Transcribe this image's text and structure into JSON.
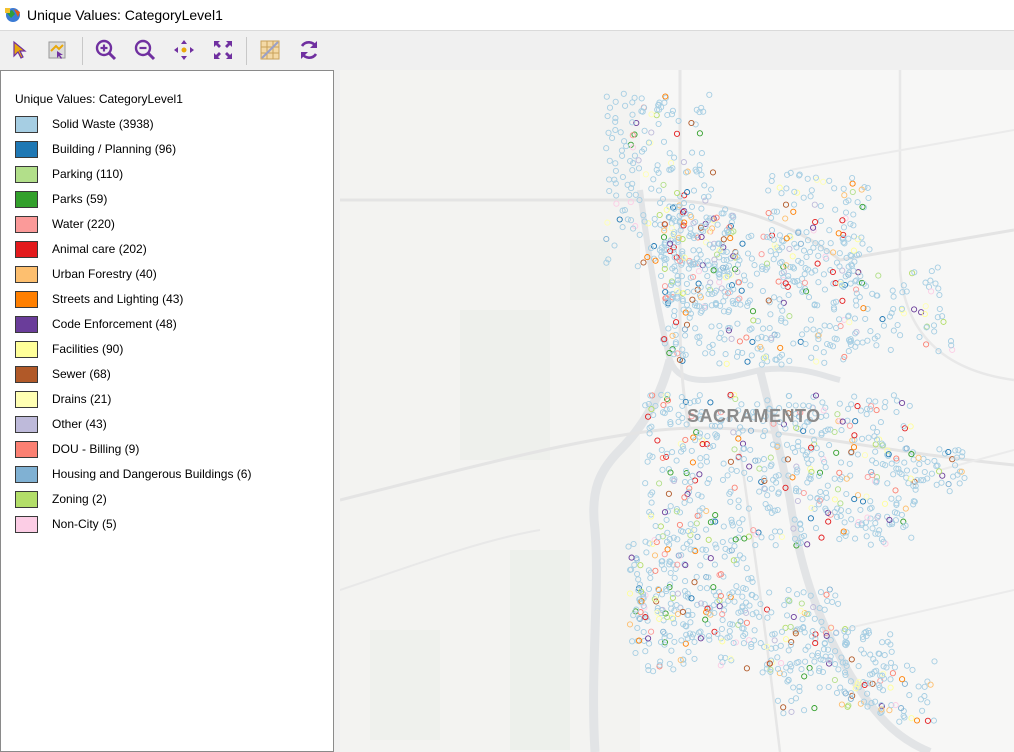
{
  "window": {
    "title": "Unique Values: CategoryLevel1"
  },
  "toolbar": {
    "buttons": [
      {
        "name": "select-pointer",
        "icon": "arrow-pointer-icon"
      },
      {
        "name": "select-map",
        "icon": "map-select-icon"
      },
      {
        "name": "zoom-in",
        "icon": "zoom-in-icon"
      },
      {
        "name": "zoom-out",
        "icon": "zoom-out-icon"
      },
      {
        "name": "pan",
        "icon": "pan-arrows-icon"
      },
      {
        "name": "full-extent",
        "icon": "fit-extent-icon"
      },
      {
        "name": "basemap",
        "icon": "basemap-grid-icon"
      },
      {
        "name": "refresh",
        "icon": "refresh-icon"
      }
    ],
    "accent": "#7030a0"
  },
  "legend": {
    "title": "Unique Values: CategoryLevel1",
    "items": [
      {
        "label": "Solid Waste (3938)",
        "color": "#a6cee3"
      },
      {
        "label": "Building / Planning (96)",
        "color": "#1f78b4"
      },
      {
        "label": "Parking (110)",
        "color": "#b2df8a"
      },
      {
        "label": "Parks (59)",
        "color": "#33a02c"
      },
      {
        "label": "Water (220)",
        "color": "#fb9a99"
      },
      {
        "label": "Animal care (202)",
        "color": "#e31a1c"
      },
      {
        "label": "Urban Forestry (40)",
        "color": "#fdbf6f"
      },
      {
        "label": "Streets and Lighting (43)",
        "color": "#ff7f00"
      },
      {
        "label": "Code Enforcement (48)",
        "color": "#6a3d9a"
      },
      {
        "label": "Facilities (90)",
        "color": "#ffff99"
      },
      {
        "label": "Sewer (68)",
        "color": "#b15928"
      },
      {
        "label": "Drains (21)",
        "color": "#ffffb3"
      },
      {
        "label": "Other (43)",
        "color": "#bebada"
      },
      {
        "label": "DOU - Billing (9)",
        "color": "#fb8072"
      },
      {
        "label": "Housing and Dangerous Buildings (6)",
        "color": "#80b1d3"
      },
      {
        "label": "Zoning (2)",
        "color": "#b3de69"
      },
      {
        "label": "Non-City (5)",
        "color": "#fccde5"
      }
    ]
  },
  "map": {
    "city_label": "SACRAMENTO"
  }
}
